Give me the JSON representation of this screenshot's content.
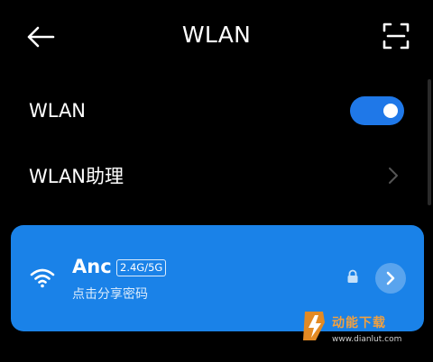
{
  "header": {
    "title": "WLAN",
    "back_icon": "arrow-left-icon",
    "scan_icon": "scan-qr-icon"
  },
  "settings": {
    "wlan_label": "WLAN",
    "wlan_enabled": true,
    "assistant_label": "WLAN助理"
  },
  "connected_network": {
    "ssid": "Anc",
    "band": "2.4G/5G",
    "share_hint": "点击分享密码",
    "secured": true
  },
  "watermark": {
    "name": "动能下载",
    "url": "www.dianlut.com"
  },
  "colors": {
    "accent": "#1a82e8",
    "toggle_on": "#1f78e8",
    "background": "#000000",
    "watermark_name": "#f0a040"
  }
}
